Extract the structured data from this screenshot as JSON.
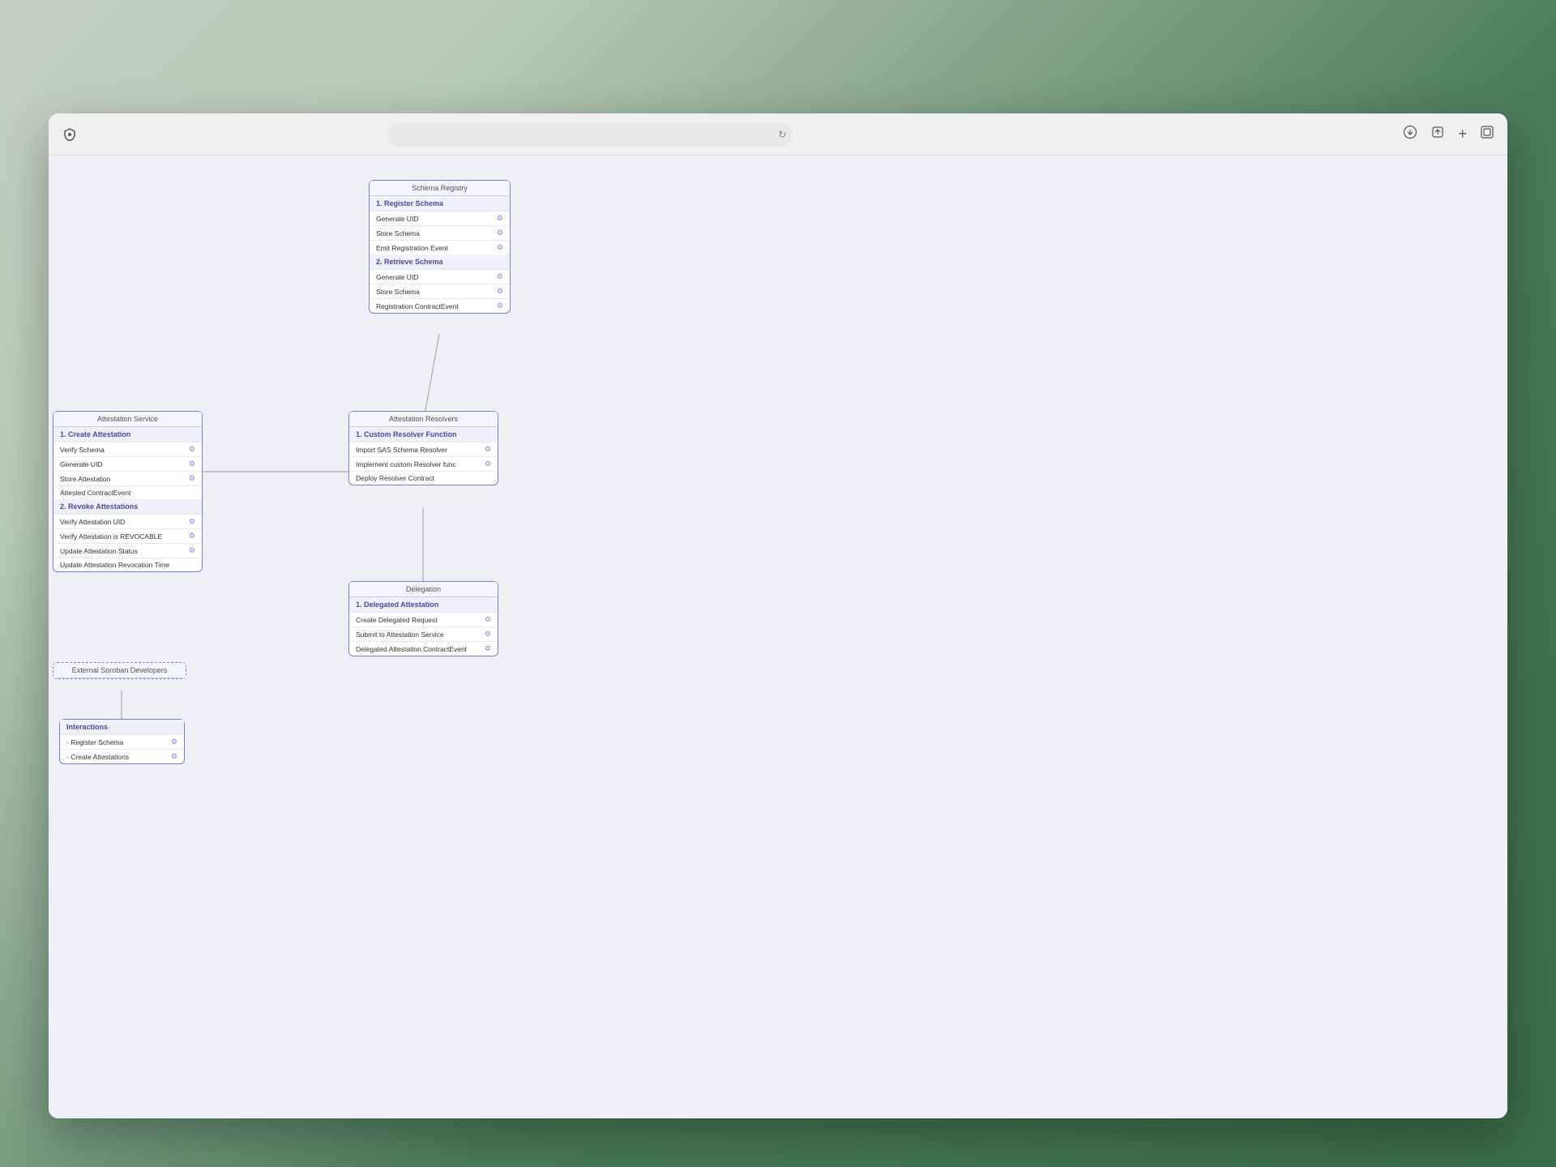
{
  "browser": {
    "shield_icon": "⊘",
    "refresh_icon": "↻",
    "download_icon": "⬇",
    "share_icon": "↑",
    "new_tab_icon": "+",
    "tabs_icon": "⧉"
  },
  "diagram": {
    "schema_registry": {
      "title": "Schema Registry",
      "section1": {
        "header": "1. Register Schema",
        "rows": [
          {
            "label": "Generate UID",
            "has_icon": true
          },
          {
            "label": "Store Schema",
            "has_icon": true
          },
          {
            "label": "Emit Registration Event",
            "has_icon": true
          }
        ]
      },
      "section2": {
        "header": "2. Retrieve Schema",
        "rows": [
          {
            "label": "Generate UID",
            "has_icon": true
          },
          {
            "label": "Store Schema",
            "has_icon": true
          },
          {
            "label": "Registration ContractEvent",
            "has_icon": true
          }
        ]
      }
    },
    "attestation_service": {
      "title": "Attestation Service",
      "section1": {
        "header": "1. Create Attestation",
        "rows": [
          {
            "label": "Verify Schema",
            "has_icon": true
          },
          {
            "label": "Generate UID",
            "has_icon": true
          },
          {
            "label": "Store Attestation",
            "has_icon": true
          },
          {
            "label": "Attested ContractEvent",
            "has_icon": false
          }
        ]
      },
      "section2": {
        "header": "2. Revoke Attestations",
        "rows": [
          {
            "label": "Verify Attestation UID",
            "has_icon": true
          },
          {
            "label": "Verify Attestation is REVOCABLE",
            "has_icon": true
          },
          {
            "label": "Update Attestation Status",
            "has_icon": true
          },
          {
            "label": "Update Attestation Revocation Time",
            "has_icon": false
          }
        ]
      }
    },
    "attestation_resolvers": {
      "title": "Attestation Resolvers",
      "section1": {
        "header": "1. Custom Resolver Function",
        "rows": [
          {
            "label": "Import SAS Schema Resolver",
            "has_icon": true
          },
          {
            "label": "Implement custom Resolver func",
            "has_icon": true
          },
          {
            "label": "Deploy Resolver Contract",
            "has_icon": false
          }
        ]
      }
    },
    "delegation": {
      "title": "Delegation",
      "section1": {
        "header": "1. Delegated Attestation",
        "rows": [
          {
            "label": "Create Delegated Request",
            "has_icon": true
          },
          {
            "label": "Submit to Attestation Service",
            "has_icon": true
          },
          {
            "label": "Delegated Attestation ContractEvent",
            "has_icon": true
          }
        ]
      }
    },
    "external_soroban": {
      "title": "External Soroban Developers"
    },
    "interactions": {
      "header": "Interactions",
      "rows": [
        {
          "label": "- Register Schema",
          "has_icon": true
        },
        {
          "label": "- Create Attestations",
          "has_icon": true
        }
      ]
    }
  }
}
